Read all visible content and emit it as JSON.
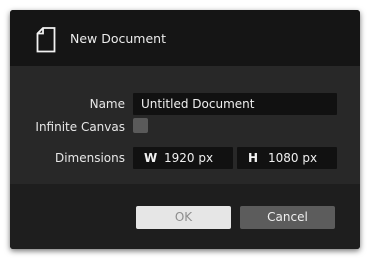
{
  "dialog": {
    "title": "New Document",
    "icon": "document-icon"
  },
  "form": {
    "name_label": "Name",
    "name_value": "Untitled Document",
    "infinite_canvas_label": "Infinite Canvas",
    "infinite_canvas_checked": false,
    "dimensions_label": "Dimensions",
    "width_axis": "W",
    "width_value": "1920 px",
    "height_axis": "H",
    "height_value": "1080 px"
  },
  "buttons": {
    "ok_label": "OK",
    "cancel_label": "Cancel"
  },
  "colors": {
    "header_bg": "#151515",
    "body_bg": "#282828",
    "footer_bg": "#1e1e1e",
    "field_bg": "#111111",
    "ok_bg": "#e6e6e6",
    "cancel_bg": "#5c5c5c"
  }
}
